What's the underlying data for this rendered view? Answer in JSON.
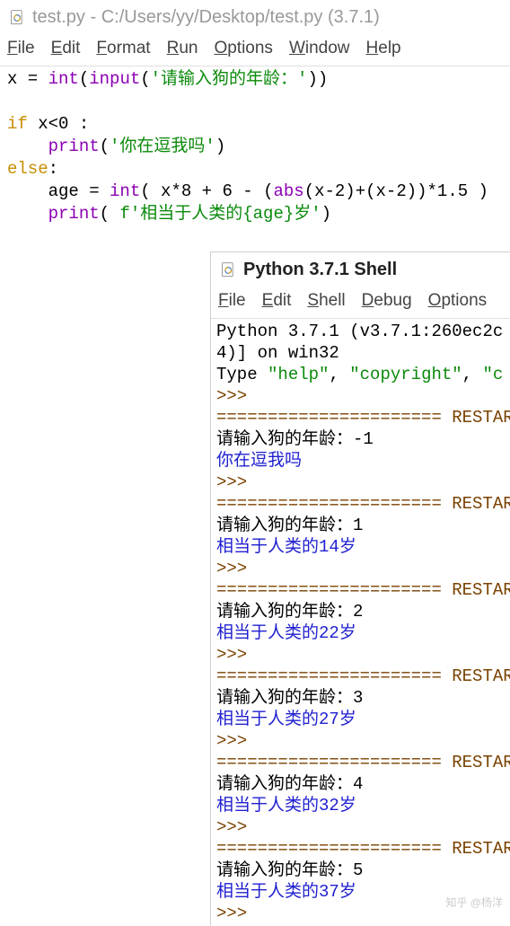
{
  "editor": {
    "title": "test.py - C:/Users/yy/Desktop/test.py (3.7.1)",
    "menu": [
      "File",
      "Edit",
      "Format",
      "Run",
      "Options",
      "Window",
      "Help"
    ],
    "code": {
      "l1_a": "x = ",
      "l1_int": "int",
      "l1_p1": "(",
      "l1_input": "input",
      "l1_p2": "(",
      "l1_str": "'请输入狗的年龄：'",
      "l1_p3": "))",
      "l2": "",
      "l3_if": "if",
      "l3_rest": " x<0 :",
      "l4_ind": "    ",
      "l4_print": "print",
      "l4_p1": "(",
      "l4_str": "'你在逗我吗'",
      "l4_p2": ")",
      "l5_else": "else",
      "l5_colon": ":",
      "l6_ind": "    age = ",
      "l6_int": "int",
      "l6_mid1": "( x*8 + 6 - (",
      "l6_abs": "abs",
      "l6_mid2": "(x-2)+(x-2))*1.5 )",
      "l7_ind": "    ",
      "l7_print": "print",
      "l7_p1": "( ",
      "l7_str": "f'相当于人类的{age}岁'",
      "l7_p2": ")"
    }
  },
  "shell": {
    "title": "Python 3.7.1 Shell",
    "menu": [
      "File",
      "Edit",
      "Shell",
      "Debug",
      "Options"
    ],
    "header_l1": "Python 3.7.1 (v3.7.1:260ec2c",
    "header_l2": "4)] on win32",
    "header_l3a": "Type ",
    "header_l3b": "\"help\"",
    "header_l3c": ", ",
    "header_l3d": "\"copyright\"",
    "header_l3e": ", ",
    "header_l3f": "\"c",
    "prompt": ">>>",
    "restart_bar": "====================== RESTART",
    "runs": [
      {
        "in": "请输入狗的年龄：-1",
        "out": "你在逗我吗"
      },
      {
        "in": "请输入狗的年龄：1",
        "out": "相当于人类的14岁"
      },
      {
        "in": "请输入狗的年龄：2",
        "out": "相当于人类的22岁"
      },
      {
        "in": "请输入狗的年龄：3",
        "out": "相当于人类的27岁"
      },
      {
        "in": "请输入狗的年龄：4",
        "out": "相当于人类的32岁"
      },
      {
        "in": "请输入狗的年龄：5",
        "out": "相当于人类的37岁"
      }
    ]
  },
  "watermark": "知乎 @杨洋"
}
